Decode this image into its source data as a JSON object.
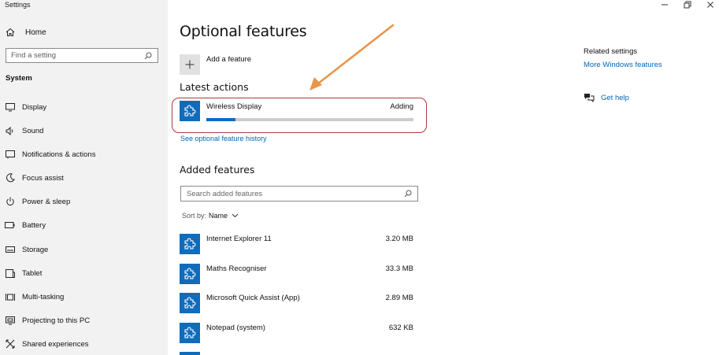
{
  "window": {
    "title": "Settings"
  },
  "sidebar": {
    "home_label": "Home",
    "search_placeholder": "Find a setting",
    "section_title": "System",
    "items": [
      {
        "label": "Display",
        "icon": "display-icon"
      },
      {
        "label": "Sound",
        "icon": "speaker-icon"
      },
      {
        "label": "Notifications & actions",
        "icon": "notification-icon"
      },
      {
        "label": "Focus assist",
        "icon": "moon-icon"
      },
      {
        "label": "Power & sleep",
        "icon": "power-icon"
      },
      {
        "label": "Battery",
        "icon": "battery-icon"
      },
      {
        "label": "Storage",
        "icon": "storage-icon"
      },
      {
        "label": "Tablet",
        "icon": "tablet-icon"
      },
      {
        "label": "Multi-tasking",
        "icon": "multitasking-icon"
      },
      {
        "label": "Projecting to this PC",
        "icon": "projecting-icon"
      },
      {
        "label": "Shared experiences",
        "icon": "shared-experiences-icon"
      }
    ]
  },
  "main": {
    "title": "Optional features",
    "add_feature_label": "Add a feature",
    "latest_actions": {
      "heading": "Latest actions",
      "items": [
        {
          "name": "Wireless Display",
          "status": "Adding",
          "progress": 0.14
        }
      ],
      "history_link": "See optional feature history"
    },
    "added_features": {
      "heading": "Added features",
      "search_placeholder": "Search added features",
      "sort_label": "Sort by:",
      "sort_value": "Name",
      "items": [
        {
          "name": "Internet Explorer 11",
          "size": "3.20 MB"
        },
        {
          "name": "Maths Recogniser",
          "size": "33.3 MB"
        },
        {
          "name": "Microsoft Quick Assist (App)",
          "size": "2.89 MB"
        },
        {
          "name": "Notepad (system)",
          "size": "632 KB"
        }
      ]
    }
  },
  "related_settings": {
    "title": "Related settings",
    "link": "More Windows features",
    "get_help": "Get help"
  },
  "colors": {
    "accent": "#0f6cbd",
    "link": "#0067b8",
    "highlight_border": "#b03a3a",
    "annotation_arrow": "#e8954a",
    "sidebar_bg": "#f2f2f2"
  }
}
